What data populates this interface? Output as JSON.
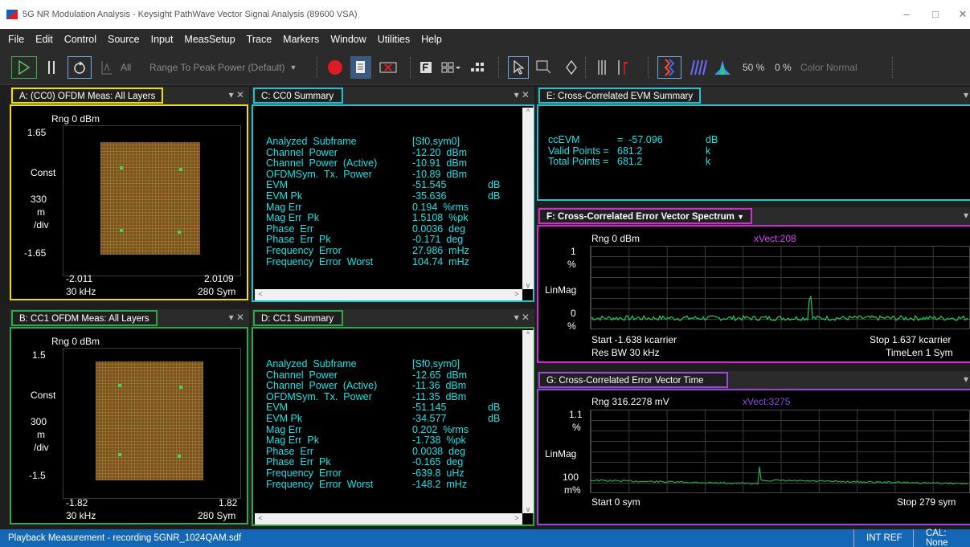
{
  "window": {
    "title": "5G NR Modulation Analysis - Keysight PathWave Vector Signal Analysis (89600 VSA)",
    "controls": [
      "–",
      "□",
      "✕"
    ]
  },
  "menu": [
    "File",
    "Edit",
    "Control",
    "Source",
    "Input",
    "MeasSetup",
    "Trace",
    "Markers",
    "Window",
    "Utilities",
    "Help"
  ],
  "toolbar": {
    "range_mode": "All",
    "range_combo": "Range To Peak Power (Default)",
    "speed_percent": "50 %",
    "zero_percent": "0 %",
    "color_combo": "Color Normal",
    "icons": [
      "play-icon",
      "pause-icon",
      "restart-icon",
      "autorange-icon",
      "record-icon",
      "copy-icon",
      "clear-icon",
      "f-icon",
      "layout-icon",
      "grid-icon",
      "pointer-icon",
      "zoom-icon",
      "marker-icon",
      "bars-icon",
      "peak-icon",
      "spectrogram-icon",
      "waterfall-icon",
      "density-icon"
    ],
    "colors": {
      "record": "#e01b24"
    }
  },
  "panels": {
    "A": {
      "title": "A: (CC0) OFDM Meas: All Layers",
      "border_color": "#f0e000",
      "rng": "Rng 0 dBm",
      "ytop": "1.65",
      "ylabel1": "Const",
      "ydiv_value": "330",
      "ydiv_unit1": "m",
      "ydiv_unit2": "/div",
      "ybottom": "-1.65",
      "xleft": "-2.011",
      "xright": "2.0109",
      "rbw": "30 kHz",
      "span": "280  Sym"
    },
    "B": {
      "title": "B: CC1 OFDM Meas: All Layers",
      "border_color": "#2ea84a",
      "rng": "Rng 0 dBm",
      "ytop": "1.5",
      "ylabel1": "Const",
      "ydiv_value": "300",
      "ydiv_unit1": "m",
      "ydiv_unit2": "/div",
      "ybottom": "-1.5",
      "xleft": "-1.82",
      "xright": "1.82",
      "rbw": "30 kHz",
      "span": "280  Sym"
    },
    "C": {
      "title": "C: CC0 Summary",
      "border_color": "#1cc6d0",
      "rows": [
        [
          "Analyzed  Subframe",
          "[Sf0,sym0]",
          ""
        ],
        [
          "Channel  Power",
          "-12.20  dBm",
          ""
        ],
        [
          "Channel  Power  (Active)",
          "-10.91  dBm",
          ""
        ],
        [
          "OFDMSym.  Tx.  Power",
          "-10.89  dBm",
          ""
        ],
        [
          "EVM",
          "-51.545",
          "dB"
        ],
        [
          "EVM Pk",
          "-35.636",
          "dB"
        ],
        [
          "Mag Err",
          "0.194  %rms",
          ""
        ],
        [
          "Mag Err  Pk",
          "1.5108  %pk",
          ""
        ],
        [
          "Phase  Err",
          "0.0036  deg",
          ""
        ],
        [
          "Phase  Err  Pk",
          "-0.171  deg",
          ""
        ],
        [
          "Frequency  Error",
          "27.986  mHz",
          ""
        ],
        [
          "Frequency  Error  Worst",
          "104.74  mHz",
          ""
        ]
      ]
    },
    "D": {
      "title": "D: CC1 Summary",
      "border_color": "#2ea84a",
      "rows": [
        [
          "Analyzed  Subframe",
          "[Sf0,sym0]",
          ""
        ],
        [
          "Channel  Power",
          "-12.65  dBm",
          ""
        ],
        [
          "Channel  Power  (Active)",
          "-11.36  dBm",
          ""
        ],
        [
          "OFDMSym.  Tx.  Power",
          "-11.35  dBm",
          ""
        ],
        [
          "EVM",
          "-51.145",
          "dB"
        ],
        [
          "EVM Pk",
          "-34.577",
          "dB"
        ],
        [
          "Mag Err",
          "0.202  %rms",
          ""
        ],
        [
          "Mag Err  Pk",
          "-1.738  %pk",
          ""
        ],
        [
          "Phase  Err",
          "0.0038  deg",
          ""
        ],
        [
          "Phase  Err  Pk",
          "-0.165  deg",
          ""
        ],
        [
          "Frequency  Error",
          "-639.8  uHz",
          ""
        ],
        [
          "Frequency  Error  Worst",
          "-148.2  mHz",
          ""
        ]
      ]
    },
    "E": {
      "title": "E: Cross-Correlated EVM Summary",
      "border_color": "#1cc6d0",
      "rows": [
        [
          "ccEVM",
          "=  -57.096",
          "dB"
        ],
        [
          "Valid Points =",
          "681.2",
          "k"
        ],
        [
          "Total Points =",
          "681.2",
          "k"
        ]
      ]
    },
    "F": {
      "title": "F: Cross-Correlated Error Vector Spectrum",
      "border_color": "#d42ad8",
      "rng": "Rng 0 dBm",
      "marker": "xVect:208",
      "ytop": "1",
      "ytop_unit": "%",
      "ylabel": "LinMag",
      "ybottom": "0",
      "ybottom_unit": "%",
      "start": "Start -1.638 kcarrier",
      "stop": "Stop 1.637 kcarrier",
      "res_bw": "Res BW 30 kHz",
      "timelen": "TimeLen 1  Sym",
      "colors": {
        "trace": "#22cc55",
        "marker": "#e040ff"
      }
    },
    "G": {
      "title": "G: Cross-Correlated Error Vector Time",
      "border_color": "#9a4ad8",
      "rng": "Rng 316.2278 mV",
      "marker": "xVect:3275",
      "ytop": "1.1",
      "ytop_unit": "%",
      "ylabel": "LinMag",
      "ybottom": "100",
      "ybottom_unit": "m%",
      "start": "Start 0  sym",
      "stop": "Stop 279  sym",
      "colors": {
        "trace": "#22aa44",
        "marker": "#8a4ae0"
      }
    }
  },
  "status": {
    "message": "Playback Measurement - recording 5GNR_1024QAM.sdf",
    "int_ref": "INT REF",
    "cal": "CAL: None"
  }
}
